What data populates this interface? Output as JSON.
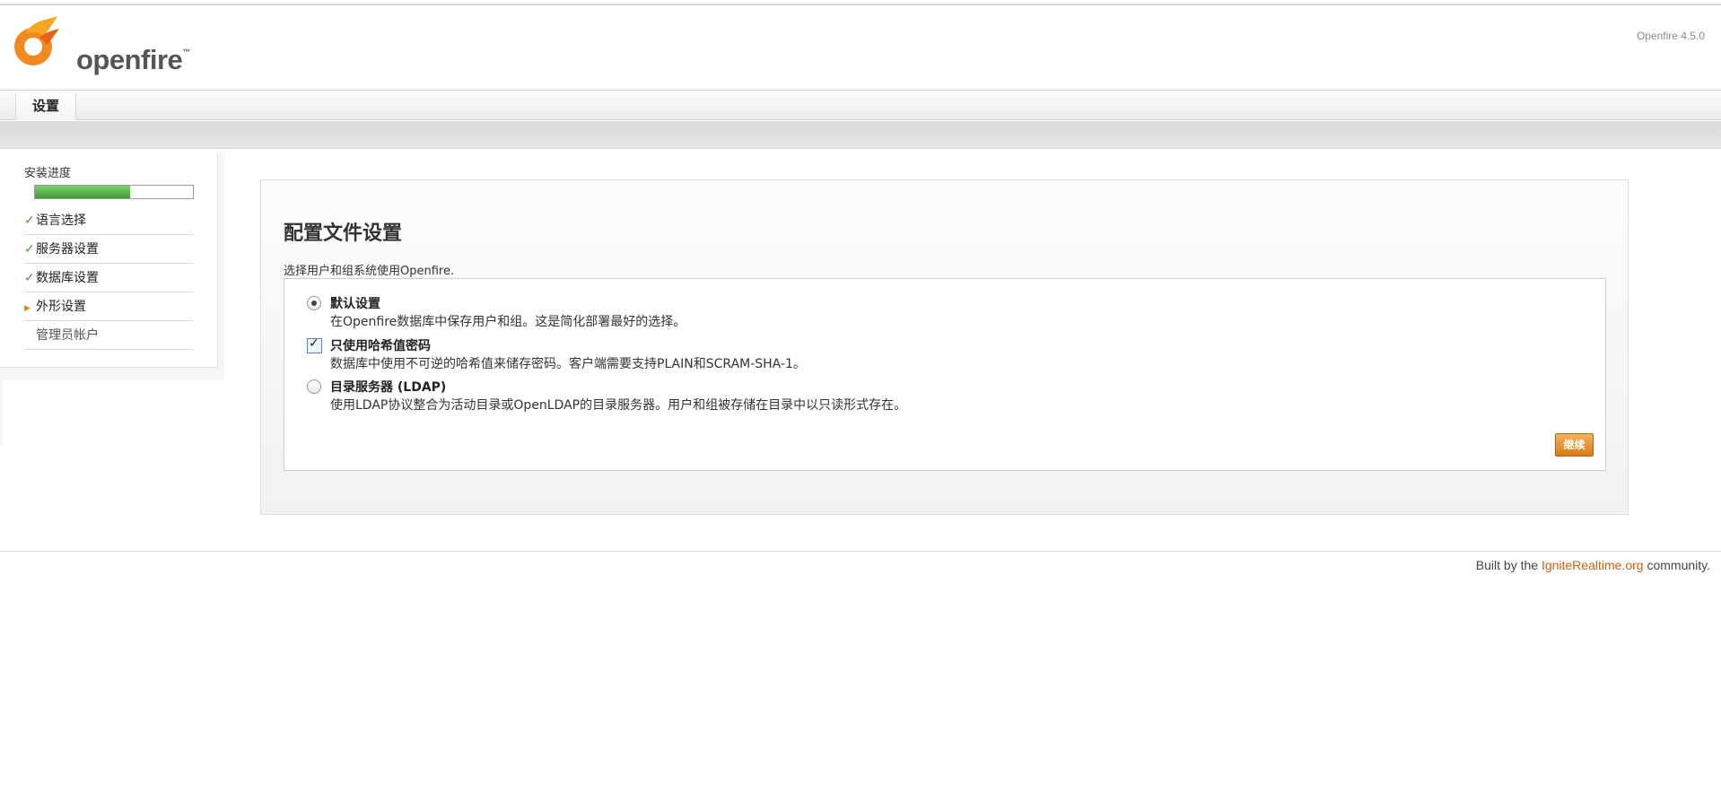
{
  "header": {
    "logo_text": "openfire",
    "version": "Openfire 4.5.0"
  },
  "tabs": [
    {
      "label": "设置"
    }
  ],
  "sidebar": {
    "progress_label": "安装进度",
    "progress_fraction": 0.6,
    "items": [
      {
        "label": "语言选择",
        "state": "done"
      },
      {
        "label": "服务器设置",
        "state": "done"
      },
      {
        "label": "数据库设置",
        "state": "done"
      },
      {
        "label": "外形设置",
        "state": "current"
      },
      {
        "label": "管理员帐户",
        "state": "pending"
      }
    ]
  },
  "main": {
    "title": "配置文件设置",
    "description": "选择用户和组系统使用Openfire.",
    "options": [
      {
        "type": "radio",
        "checked": true,
        "title": "默认设置",
        "description": "在Openfire数据库中保存用户和组。这是简化部署最好的选择。"
      },
      {
        "type": "checkbox",
        "checked": true,
        "title": "只使用哈希值密码",
        "description": "数据库中使用不可逆的哈希值来储存密码。客户端需要支持PLAIN和SCRAM-SHA-1。"
      },
      {
        "type": "radio",
        "checked": false,
        "title": "目录服务器 (LDAP)",
        "description": "使用LDAP协议整合为活动目录或OpenLDAP的目录服务器。用户和组被存储在目录中以只读形式存在。"
      }
    ],
    "continue_label": "继续"
  },
  "footer": {
    "prefix": "Built by the ",
    "link": "IgniteRealtime.org",
    "suffix": " community."
  },
  "colors": {
    "brand_orange": "#e8761a",
    "progress_green": "#4caf3e",
    "link_orange": "#d0600a"
  }
}
